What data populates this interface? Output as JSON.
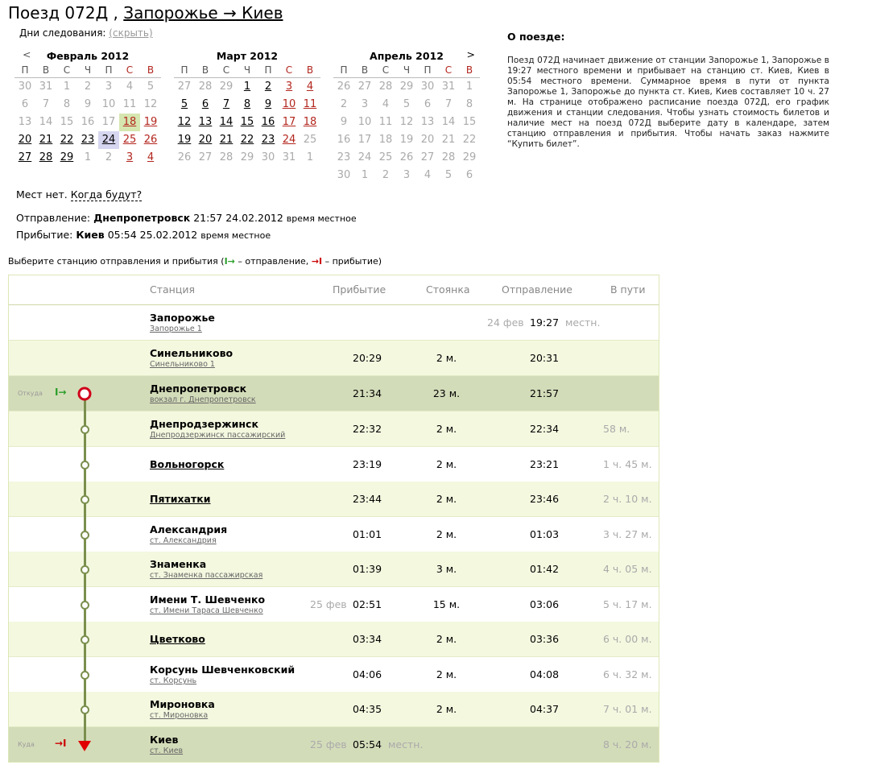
{
  "header": {
    "prefix": "Поезд 072Д ,",
    "route": "Запорожье → Киев"
  },
  "days": {
    "label": "Дни следования:",
    "hide": "(скрыть)"
  },
  "calendar": {
    "prev": "<",
    "next": ">",
    "weekdays": [
      "П",
      "В",
      "С",
      "Ч",
      "П",
      "С",
      "В"
    ],
    "months": [
      {
        "title": "Февраль 2012",
        "days": [
          [
            "30",
            "grey"
          ],
          [
            "31",
            "grey"
          ],
          [
            "1",
            "grey"
          ],
          [
            "2",
            "grey"
          ],
          [
            "3",
            "grey"
          ],
          [
            "4",
            "grey"
          ],
          [
            "5",
            "grey"
          ],
          [
            "6",
            "grey"
          ],
          [
            "7",
            "grey"
          ],
          [
            "8",
            "grey"
          ],
          [
            "9",
            "grey"
          ],
          [
            "10",
            "grey"
          ],
          [
            "11",
            "grey"
          ],
          [
            "12",
            "grey"
          ],
          [
            "13",
            "grey"
          ],
          [
            "14",
            "grey"
          ],
          [
            "15",
            "grey"
          ],
          [
            "16",
            "grey"
          ],
          [
            "17",
            "grey"
          ],
          [
            "18",
            "sel"
          ],
          [
            "19",
            "actred"
          ],
          [
            "20",
            "act"
          ],
          [
            "21",
            "act"
          ],
          [
            "22",
            "act"
          ],
          [
            "23",
            "act"
          ],
          [
            "24",
            "cur"
          ],
          [
            "25",
            "actred"
          ],
          [
            "26",
            "actred"
          ],
          [
            "27",
            "act"
          ],
          [
            "28",
            "act"
          ],
          [
            "29",
            "act"
          ],
          [
            "1",
            "grey"
          ],
          [
            "2",
            "grey"
          ],
          [
            "3",
            "actred"
          ],
          [
            "4",
            "actred"
          ]
        ]
      },
      {
        "title": "Март 2012",
        "days": [
          [
            "27",
            "grey"
          ],
          [
            "28",
            "grey"
          ],
          [
            "29",
            "grey"
          ],
          [
            "1",
            "act"
          ],
          [
            "2",
            "act"
          ],
          [
            "3",
            "actred"
          ],
          [
            "4",
            "actred"
          ],
          [
            "5",
            "act"
          ],
          [
            "6",
            "act"
          ],
          [
            "7",
            "act"
          ],
          [
            "8",
            "act"
          ],
          [
            "9",
            "act"
          ],
          [
            "10",
            "actred"
          ],
          [
            "11",
            "actred"
          ],
          [
            "12",
            "act"
          ],
          [
            "13",
            "act"
          ],
          [
            "14",
            "act"
          ],
          [
            "15",
            "act"
          ],
          [
            "16",
            "act"
          ],
          [
            "17",
            "actred"
          ],
          [
            "18",
            "actred"
          ],
          [
            "19",
            "act"
          ],
          [
            "20",
            "act"
          ],
          [
            "21",
            "act"
          ],
          [
            "22",
            "act"
          ],
          [
            "23",
            "act"
          ],
          [
            "24",
            "actred"
          ],
          [
            "25",
            "grey"
          ],
          [
            "26",
            "grey"
          ],
          [
            "27",
            "grey"
          ],
          [
            "28",
            "grey"
          ],
          [
            "29",
            "grey"
          ],
          [
            "30",
            "grey"
          ],
          [
            "31",
            "grey"
          ],
          [
            "1",
            "grey"
          ]
        ]
      },
      {
        "title": "Апрель 2012",
        "days": [
          [
            "26",
            "grey"
          ],
          [
            "27",
            "grey"
          ],
          [
            "28",
            "grey"
          ],
          [
            "29",
            "grey"
          ],
          [
            "30",
            "grey"
          ],
          [
            "31",
            "grey"
          ],
          [
            "1",
            "grey"
          ],
          [
            "2",
            "grey"
          ],
          [
            "3",
            "grey"
          ],
          [
            "4",
            "grey"
          ],
          [
            "5",
            "grey"
          ],
          [
            "6",
            "grey"
          ],
          [
            "7",
            "grey"
          ],
          [
            "8",
            "grey"
          ],
          [
            "9",
            "grey"
          ],
          [
            "10",
            "grey"
          ],
          [
            "11",
            "grey"
          ],
          [
            "12",
            "grey"
          ],
          [
            "13",
            "grey"
          ],
          [
            "14",
            "grey"
          ],
          [
            "15",
            "grey"
          ],
          [
            "16",
            "grey"
          ],
          [
            "17",
            "grey"
          ],
          [
            "18",
            "grey"
          ],
          [
            "19",
            "grey"
          ],
          [
            "20",
            "grey"
          ],
          [
            "21",
            "grey"
          ],
          [
            "22",
            "grey"
          ],
          [
            "23",
            "grey"
          ],
          [
            "24",
            "grey"
          ],
          [
            "25",
            "grey"
          ],
          [
            "26",
            "grey"
          ],
          [
            "27",
            "grey"
          ],
          [
            "28",
            "grey"
          ],
          [
            "29",
            "grey"
          ],
          [
            "30",
            "grey"
          ],
          [
            "1",
            "grey"
          ],
          [
            "2",
            "grey"
          ],
          [
            "3",
            "grey"
          ],
          [
            "4",
            "grey"
          ],
          [
            "5",
            "grey"
          ],
          [
            "6",
            "grey"
          ]
        ]
      }
    ]
  },
  "availability": {
    "text": "Мест нет.",
    "when": "Когда будут?"
  },
  "departure": {
    "label": "Отправление:",
    "station": "Днепропетровск",
    "time": "21:57 24.02.2012",
    "local": "время местное"
  },
  "arrival": {
    "label": "Прибытие:",
    "station": "Киев",
    "time": "05:54 25.02.2012",
    "local": "время местное"
  },
  "hint": {
    "text": "Выберите станцию отправления и прибытия (",
    "dep_icon": "I→",
    "dep_text": " – отправление, ",
    "arr_icon": "→I",
    "arr_text": " – прибытие)"
  },
  "about": {
    "title": "О поезде:",
    "text": "Поезд 072Д начинает движение от станции Запорожье 1, Запорожье в 19:27 местного времени и прибывает на станцию ст. Киев, Киев в 05:54 местного времени. Суммарное время в пути от пункта Запорожье 1, Запорожье до пункта ст. Киев, Киев составляет 10 ч. 27 м. На странице отображено расписание поезда 072Д, его график движения и станции следования. Чтобы узнать стоимость билетов и наличие мест на поезд 072Д выберите дату в календаре, затем станцию отправления и прибытия. Чтобы начать заказ нажмите “Купить билет”."
  },
  "table": {
    "headers": {
      "station": "Станция",
      "arrival": "Прибытие",
      "stop": "Стоянка",
      "departure": "Отправление",
      "travel": "В пути"
    },
    "from_label": "Откуда",
    "to_label": "Куда",
    "from_icon": "I→",
    "to_icon": "→I",
    "rows": [
      {
        "name": "Запорожье",
        "sub": "Запорожье 1",
        "arr": "",
        "stop": "",
        "date_dep": "24 фев",
        "dep": "19:27",
        "dep_note": "местн.",
        "travel": ""
      },
      {
        "name": "Синельниково",
        "sub": "Синельниково 1",
        "arr": "20:29",
        "stop": "2 м.",
        "dep": "20:31",
        "travel": ""
      },
      {
        "name": "Днепропетровск",
        "sub": "вокзал г. Днепропетровск",
        "arr": "21:34",
        "stop": "23 м.",
        "dep": "21:57",
        "travel": ""
      },
      {
        "name": "Днепродзержинск",
        "sub": "Днепродзержинск пассажирский",
        "arr": "22:32",
        "stop": "2 м.",
        "dep": "22:34",
        "travel": "58 м."
      },
      {
        "name": "Вольногорск",
        "sub": "",
        "arr": "23:19",
        "stop": "2 м.",
        "dep": "23:21",
        "travel": "1 ч. 45 м."
      },
      {
        "name": "Пятихатки",
        "sub": "",
        "arr": "23:44",
        "stop": "2 м.",
        "dep": "23:46",
        "travel": "2 ч. 10 м."
      },
      {
        "name": "Александрия",
        "sub": "ст. Александрия",
        "arr": "01:01",
        "stop": "2 м.",
        "dep": "01:03",
        "travel": "3 ч. 27 м."
      },
      {
        "name": "Знаменка",
        "sub": "ст. Знаменка пассажирская",
        "arr": "01:39",
        "stop": "3 м.",
        "dep": "01:42",
        "travel": "4 ч. 05 м."
      },
      {
        "name": "Имени Т. Шевченко",
        "sub": "ст. Имени Тараса Шевченко",
        "date_arr": "25 фев",
        "arr": "02:51",
        "stop": "15 м.",
        "dep": "03:06",
        "travel": "5 ч. 17 м."
      },
      {
        "name": "Цветково",
        "sub": "",
        "arr": "03:34",
        "stop": "2 м.",
        "dep": "03:36",
        "travel": "6 ч. 00 м."
      },
      {
        "name": "Корсунь Шевченковский",
        "sub": "ст. Корсунь",
        "arr": "04:06",
        "stop": "2 м.",
        "dep": "04:08",
        "travel": "6 ч. 32 м."
      },
      {
        "name": "Мироновка",
        "sub": "ст. Мироновка",
        "arr": "04:35",
        "stop": "2 м.",
        "dep": "04:37",
        "travel": "7 ч. 01 м."
      },
      {
        "name": "Киев",
        "sub": "ст. Киев",
        "date_arr": "25 фев",
        "arr": "05:54",
        "arr_note": "местн.",
        "stop": "",
        "dep": "",
        "travel": "8 ч. 20 м."
      }
    ]
  }
}
